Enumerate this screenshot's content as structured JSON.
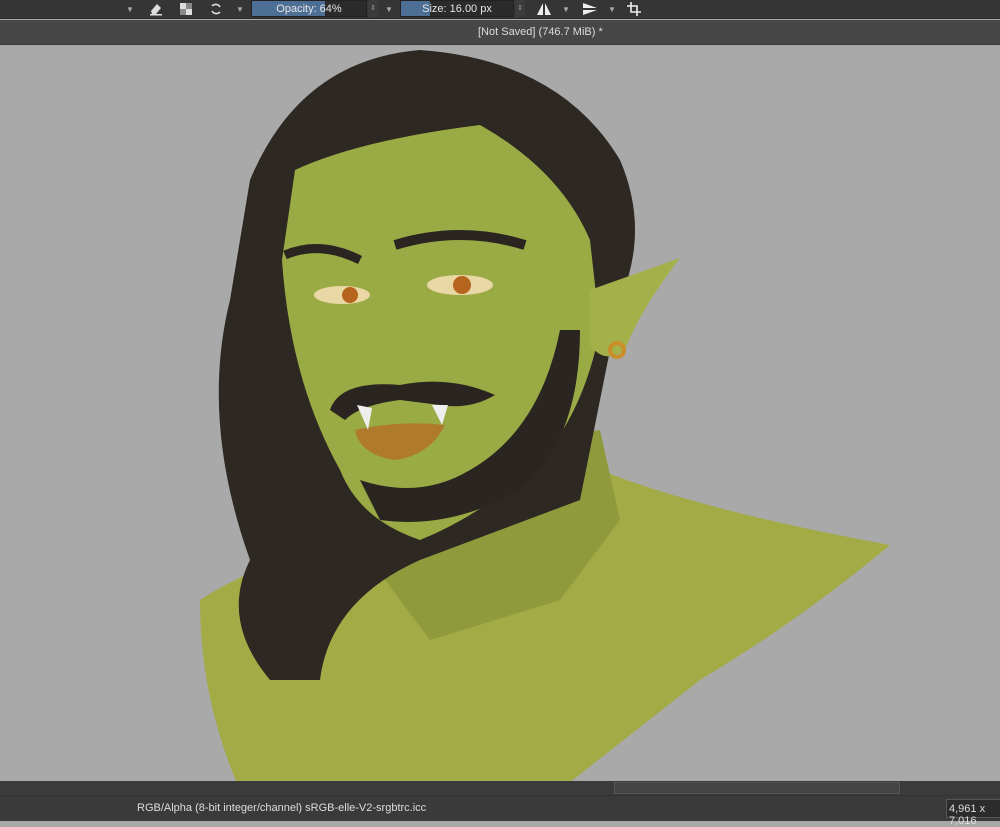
{
  "toolbar": {
    "opacity_label": "Opacity: 64%",
    "opacity_value": 0.64,
    "size_label": "Size: 16.00 px",
    "size_fill": 0.2
  },
  "title": "[Not Saved]  (746.7 MiB) *",
  "status": {
    "color_space": "RGB/Alpha (8-bit integer/channel)  sRGB-elle-V2-srgbtrc.icc",
    "dimensions": "4,961 x 7,016"
  }
}
